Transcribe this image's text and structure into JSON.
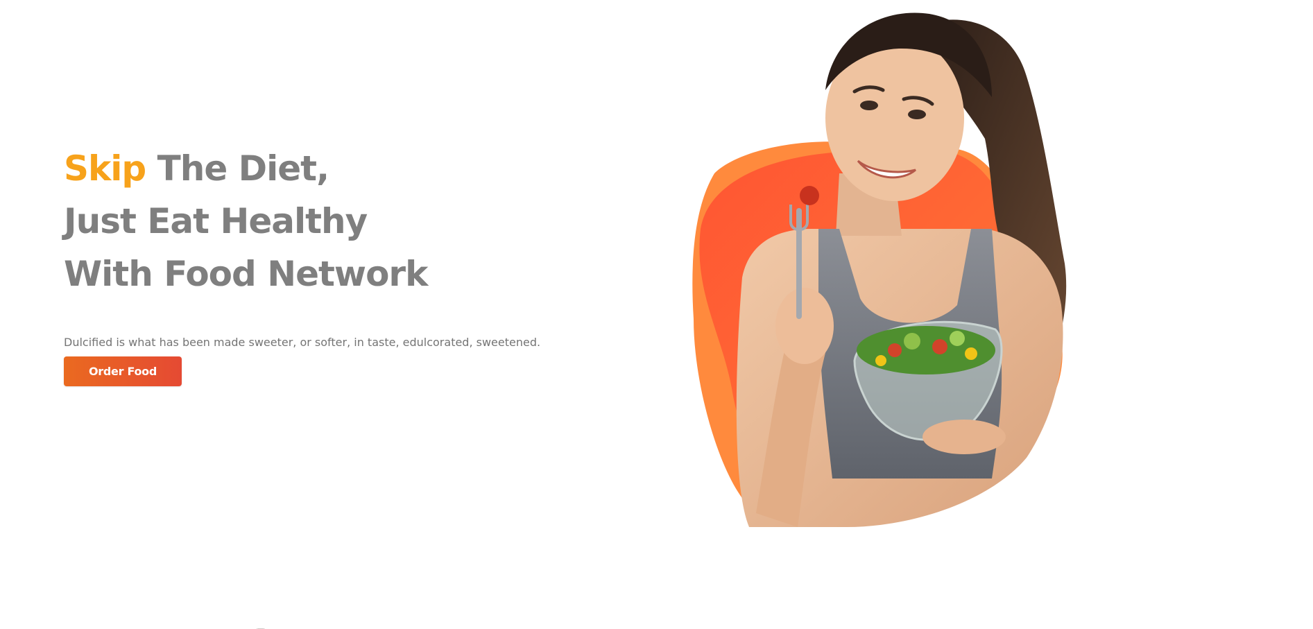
{
  "hero": {
    "headline": {
      "accent_word": "Skip",
      "line1_rest": " The Diet,",
      "line2": "Just Eat Healthy",
      "line3": "With Food Network"
    },
    "tagline": "Dulcified is what has been made sweeter, or softer, in taste, edulcorated, sweetened.",
    "cta_label": "Order Food"
  },
  "image": {
    "subject": "woman-eating-salad-photo",
    "background_shape": "orange-blob"
  },
  "colors": {
    "accent": "#f7a21b",
    "headline_text": "#7f7f7f",
    "body_text": "#747474",
    "button_start": "#ea6a20",
    "button_end": "#e54a33",
    "blob_orange": "#ff8a3d",
    "blob_red": "#ff5533"
  }
}
